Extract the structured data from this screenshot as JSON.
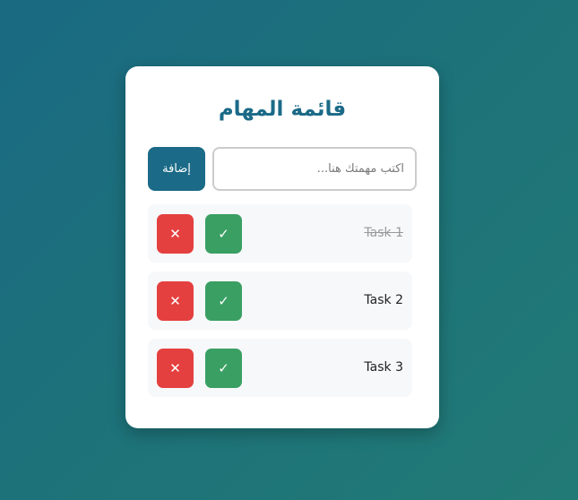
{
  "app": {
    "title": "قائمة المهام"
  },
  "form": {
    "add_label": "إضافة",
    "input_value": "",
    "input_placeholder": "اكتب مهمتك هنا..."
  },
  "tasks": [
    {
      "text": "Task 1",
      "completed": true,
      "complete_icon": "✓",
      "delete_icon": "✕"
    },
    {
      "text": "Task 2",
      "completed": false,
      "complete_icon": "✓",
      "delete_icon": "✕"
    },
    {
      "text": "Task 3",
      "completed": false,
      "complete_icon": "✓",
      "delete_icon": "✕"
    }
  ],
  "colors": {
    "accent": "#1b6a87",
    "complete": "#3a9f63",
    "delete": "#e4403f"
  },
  "icons": {
    "complete": "check-icon",
    "delete": "close-icon"
  }
}
